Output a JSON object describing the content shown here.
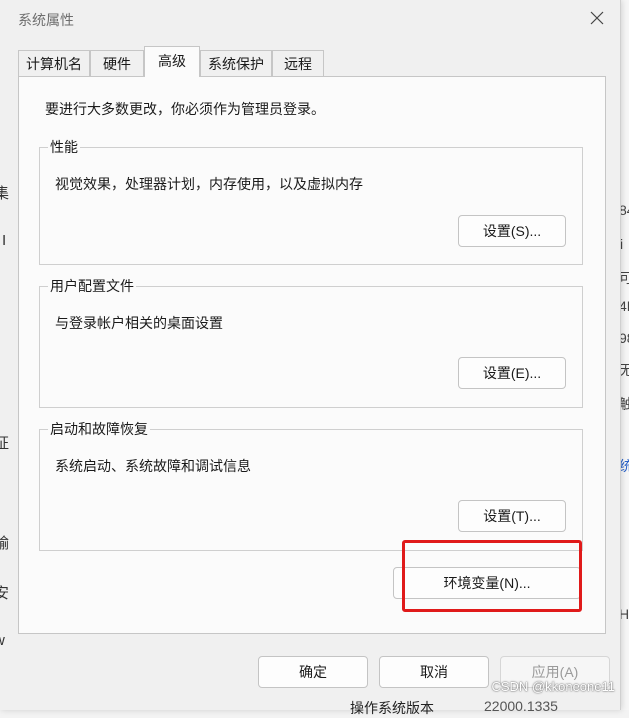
{
  "window": {
    "title": "系统属性"
  },
  "tabs": [
    {
      "label": "计算机名",
      "active": false
    },
    {
      "label": "硬件",
      "active": false
    },
    {
      "label": "高级",
      "active": true
    },
    {
      "label": "系统保护",
      "active": false
    },
    {
      "label": "远程",
      "active": false
    }
  ],
  "admin_note": "要进行大多数更改，你必须作为管理员登录。",
  "groups": [
    {
      "title": "性能",
      "description": "视觉效果，处理器计划，内存使用，以及虚拟内存",
      "button": "设置(S)..."
    },
    {
      "title": "用户配置文件",
      "description": "与登录帐户相关的桌面设置",
      "button": "设置(E)..."
    },
    {
      "title": "启动和故障恢复",
      "description": "系统启动、系统故障和调试信息",
      "button": "设置(T)..."
    }
  ],
  "env_button": "环境变量(N)...",
  "footer": {
    "ok": "确定",
    "cancel": "取消",
    "apply": "应用(A)"
  },
  "watermark": "CSDN @kkoneone11",
  "background": {
    "right_glyphs": [
      "84",
      "i",
      "可",
      "4P",
      "98",
      "无",
      "触",
      "统",
      "H"
    ],
    "left_glyphs": [
      "集",
      "I",
      "证",
      "输",
      "安",
      "w"
    ],
    "bottom_label": "操作系统版本",
    "bottom_value": "22000.1335"
  },
  "colors": {
    "highlight": "#e01a1a",
    "panel": "#fbfbfb",
    "dialog": "#f0f0f0"
  }
}
